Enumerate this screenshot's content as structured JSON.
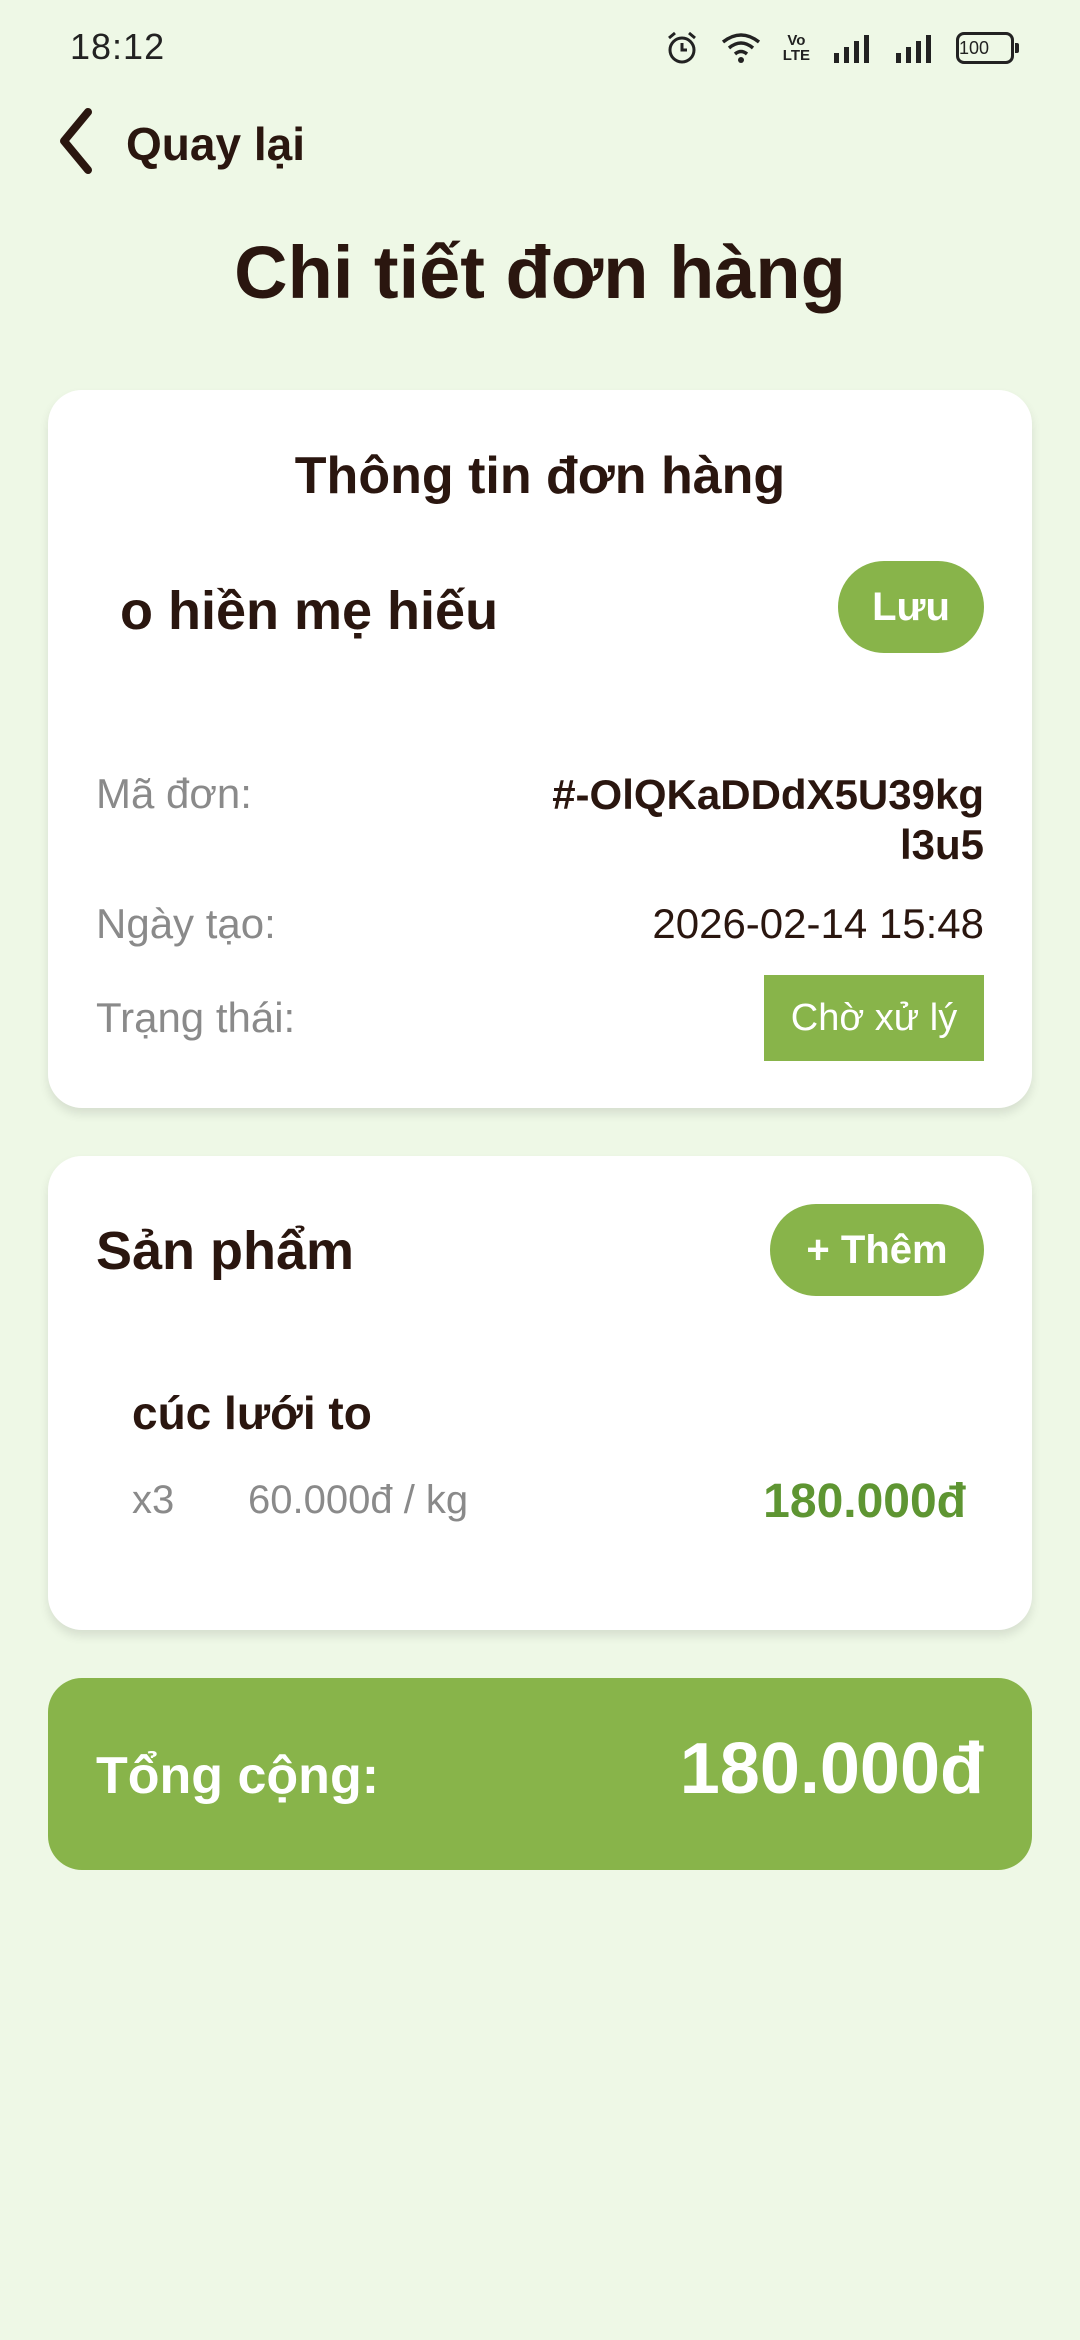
{
  "status_bar": {
    "time": "18:12",
    "volte_top": "Vo",
    "volte_bottom": "LTE",
    "battery": "100",
    "icons": [
      "alarm-icon",
      "wifi-icon",
      "volte-icon",
      "signal-icon",
      "signal-icon",
      "battery-icon"
    ]
  },
  "nav": {
    "back_icon": "chevron-left-icon",
    "back_label": "Quay lại"
  },
  "page": {
    "title": "Chi tiết đơn hàng"
  },
  "order_info": {
    "heading": "Thông tin đơn hàng",
    "customer_name": "o hiền mẹ hiếu",
    "save_label": "Lưu",
    "code_label": "Mã đơn:",
    "code_value": "#-OlQKaDDdX5U39kgl3u5",
    "date_label": "Ngày tạo:",
    "date_value": "2026-02-14 15:48",
    "status_label": "Trạng thái:",
    "status_value": "Chờ xử lý"
  },
  "products": {
    "heading": "Sản phẩm",
    "add_label": "+ Thêm",
    "items": [
      {
        "name": "cúc lưới to",
        "qty": "x3",
        "unit_price": "60.000đ / kg",
        "line_total": "180.000đ"
      }
    ]
  },
  "summary": {
    "total_label": "Tổng cộng:",
    "total_value": "180.000đ"
  },
  "colors": {
    "background": "#eef8e6",
    "accent": "#88b44a",
    "price_text": "#5e9532",
    "primary_text": "#2a160f"
  }
}
